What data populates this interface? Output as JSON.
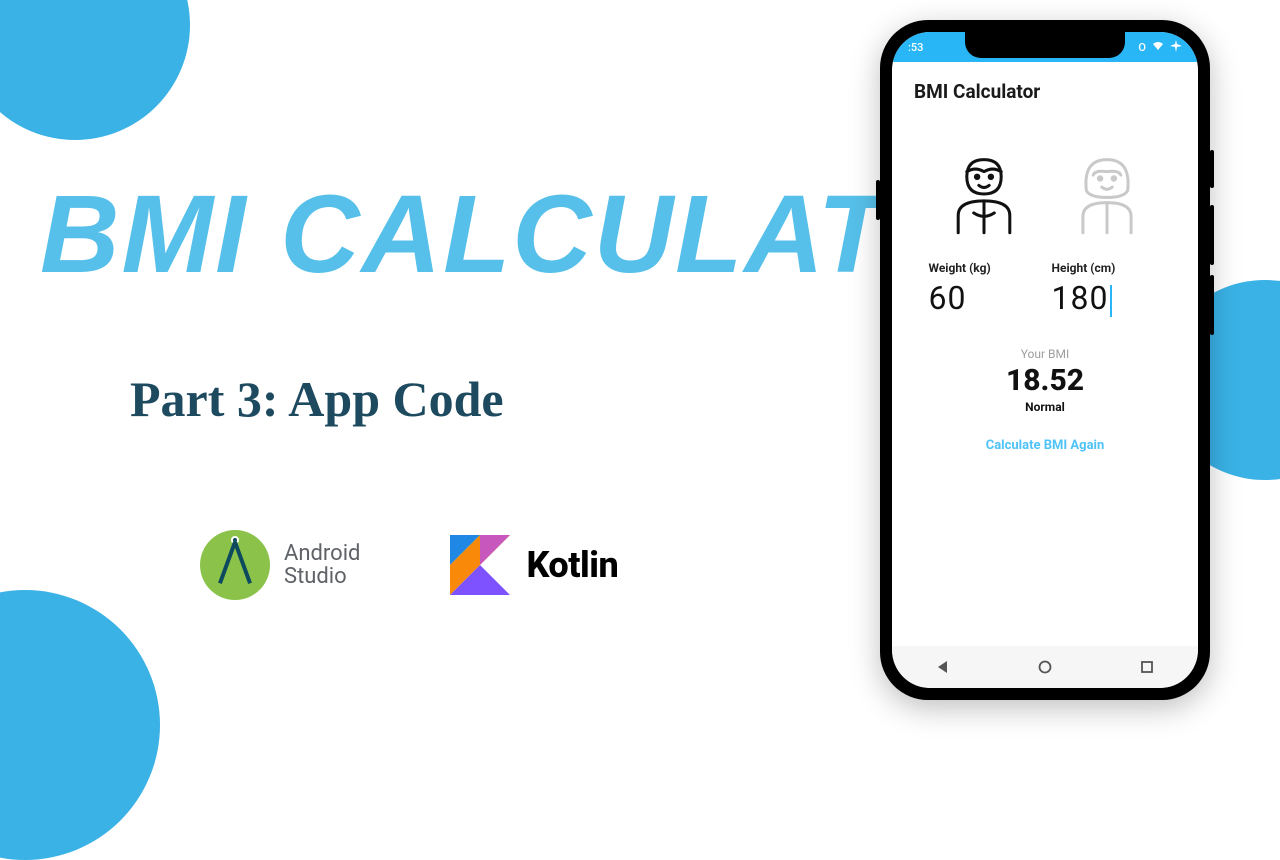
{
  "colors": {
    "accent": "#56c0ea",
    "dark": "#1e4a5f",
    "statusbar": "#29b6f6"
  },
  "title": "BMI CALCULATOR",
  "subtitle": "Part 3: App Code",
  "logos": {
    "android_studio": "Android\nStudio",
    "kotlin": "Kotlin"
  },
  "phone": {
    "status": {
      "time": ":53",
      "indicators": "O",
      "wifi": true,
      "airplane": true
    },
    "app_title": "BMI Calculator",
    "genders": {
      "male": {
        "label": "Male",
        "selected": true
      },
      "female": {
        "label": "Female",
        "selected": false
      }
    },
    "inputs": {
      "weight": {
        "label": "Weight (kg)",
        "value": "60"
      },
      "height": {
        "label": "Height (cm)",
        "value": "180"
      }
    },
    "result": {
      "label": "Your BMI",
      "value": "18.52",
      "status": "Normal"
    },
    "action": "Calculate BMI Again"
  }
}
